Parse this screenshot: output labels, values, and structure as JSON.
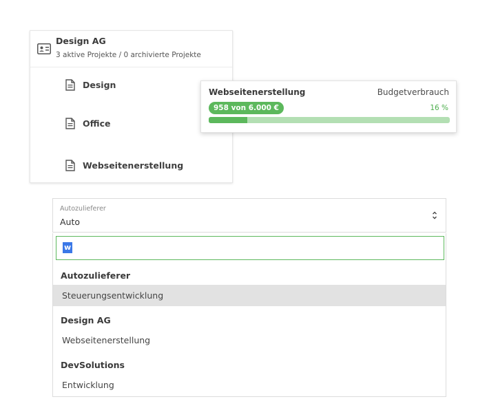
{
  "client_card": {
    "name": "Design AG",
    "summary": "3 aktive Projekte / 0 archivierte Projekte",
    "projects": [
      {
        "label": "Design"
      },
      {
        "label": "Office"
      },
      {
        "label": "Webseitenerstellung"
      }
    ]
  },
  "budget_popover": {
    "project": "Webseitenerstellung",
    "label": "Budgetverbrauch",
    "amount": "958 von 6.000 €",
    "percent_text": "16 %",
    "percent_value": 16,
    "colors": {
      "fill": "#5cb85c",
      "track": "#b3dfb3"
    }
  },
  "select": {
    "label": "Autozulieferer",
    "value": "Auto"
  },
  "dropdown": {
    "search_value": "w",
    "groups": [
      {
        "name": "Autozulieferer",
        "options": [
          "Steuerungsentwicklung"
        ]
      },
      {
        "name": "Design AG",
        "options": [
          "Webseitenerstellung"
        ]
      },
      {
        "name": "DevSolutions",
        "options": [
          "Entwicklung"
        ]
      }
    ],
    "highlighted_option": "Steuerungsentwicklung"
  }
}
